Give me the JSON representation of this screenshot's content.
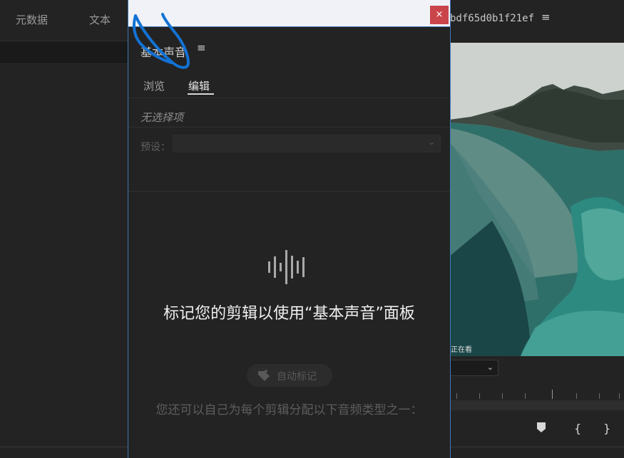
{
  "left_panel": {
    "tabs": [
      "元数据",
      "文本"
    ]
  },
  "right_panel": {
    "title": "bdf65d0b1f21ef",
    "menu_icon": "hamburger-icon",
    "video_caption": "正在看",
    "dropdown_icon": "chevron-down-icon",
    "controls": [
      "marker-icon",
      "in-point-icon",
      "out-point-icon"
    ]
  },
  "window": {
    "close_label": "×",
    "panel_title": "基本声音",
    "menu_icon": "hamburger-icon",
    "tabs": [
      {
        "label": "浏览",
        "active": false
      },
      {
        "label": "编辑",
        "active": true
      }
    ],
    "no_selection": "无选择项",
    "preset_label": "预设：",
    "preset_value": "",
    "heading": "标记您的剪辑以使用“基本声音”面板",
    "auto_tag_label": "自动标记",
    "sub_text": "您还可以自己为每个剪辑分配以下音频类型之一："
  },
  "colors": {
    "accent_border": "#3f78b7",
    "close_button": "#c9454a",
    "annotation": "#1272d4"
  }
}
